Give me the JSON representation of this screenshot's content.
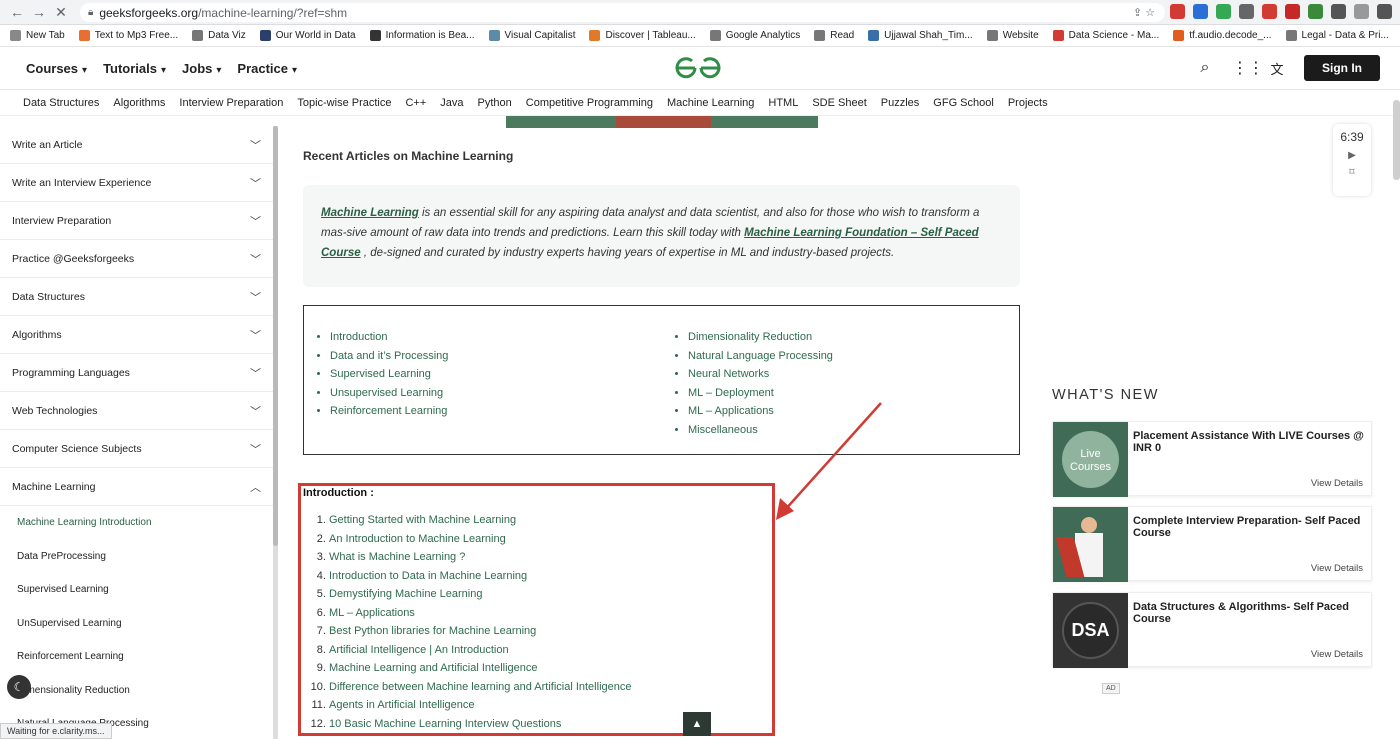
{
  "browser": {
    "url_host": "geeksforgeeks.org",
    "url_path": "/machine-learning/?ref=shm",
    "bookmarks": [
      {
        "label": "New Tab",
        "color": "#888"
      },
      {
        "label": "Text to Mp3 Free...",
        "color": "#e76f2f"
      },
      {
        "label": "Data Viz",
        "color": "#777"
      },
      {
        "label": "Our World in Data",
        "color": "#2a3f6a"
      },
      {
        "label": "Information is Bea...",
        "color": "#333"
      },
      {
        "label": "Visual Capitalist",
        "color": "#5c8aa8"
      },
      {
        "label": "Discover | Tableau...",
        "color": "#e07a2a"
      },
      {
        "label": "Google Analytics",
        "color": "#777"
      },
      {
        "label": "Read",
        "color": "#777"
      },
      {
        "label": "Ujjawal Shah_Tim...",
        "color": "#3a6ea8"
      },
      {
        "label": "Website",
        "color": "#777"
      },
      {
        "label": "Data Science - Ma...",
        "color": "#d13b34"
      },
      {
        "label": "tf.audio.decode_...",
        "color": "#e25b1f"
      },
      {
        "label": "Legal - Data & Pri...",
        "color": "#777"
      }
    ],
    "status_text": "Waiting for e.clarity.ms..."
  },
  "header": {
    "topnav": [
      "Courses",
      "Tutorials",
      "Jobs",
      "Practice"
    ],
    "signin_label": "Sign In",
    "logo_color": "#2f8d46"
  },
  "subnav": [
    "Data Structures",
    "Algorithms",
    "Interview Preparation",
    "Topic-wise Practice",
    "C++",
    "Java",
    "Python",
    "Competitive Programming",
    "Machine Learning",
    "HTML",
    "SDE Sheet",
    "Puzzles",
    "GFG School",
    "Projects"
  ],
  "sidebar": {
    "items": [
      {
        "label": "Write an Article",
        "chevron": "down"
      },
      {
        "label": "Write an Interview Experience",
        "chevron": "down"
      },
      {
        "label": "Interview Preparation",
        "chevron": "down"
      },
      {
        "label": "Practice @Geeksforgeeks",
        "chevron": "down"
      },
      {
        "label": "Data Structures",
        "chevron": "down"
      },
      {
        "label": "Algorithms",
        "chevron": "down"
      },
      {
        "label": "Programming Languages",
        "chevron": "down"
      },
      {
        "label": "Web Technologies",
        "chevron": "down"
      },
      {
        "label": "Computer Science Subjects",
        "chevron": "down"
      },
      {
        "label": "Machine Learning",
        "chevron": "up"
      }
    ],
    "sub_items": [
      "Machine Learning Introduction",
      "Data PreProcessing",
      "Supervised Learning",
      "UnSupervised Learning",
      "Reinforcement Learning",
      "Dimensionality Reduction",
      "Natural Language Processing"
    ]
  },
  "main": {
    "section_title": "Recent Articles on Machine Learning",
    "promo": {
      "link1": "Machine Learning",
      "text1": " is an essential skill for any aspiring data analyst and data scientist, and also for those who wish to transform a mas-sive amount of raw data into trends and predictions. Learn this skill today with ",
      "link2": "Machine Learning Foundation – Self Paced Course",
      "text2": " , de-signed and curated by industry experts having years of expertise in ML and industry-based projects."
    },
    "toc_left": [
      "Introduction",
      "Data and it’s Processing",
      "Supervised Learning",
      "Unsupervised Learning",
      "Reinforcement Learning"
    ],
    "toc_right": [
      "Dimensionality Reduction",
      "Natural Language Processing",
      "Neural Networks",
      "ML – Deployment",
      "ML – Applications",
      "Miscellaneous"
    ],
    "intro_heading": "Introduction :",
    "intro_items": [
      "Getting Started with Machine Learning",
      "An Introduction to Machine Learning",
      "What is Machine Learning ?",
      "Introduction to Data in Machine Learning",
      "Demystifying Machine Learning",
      "ML – Applications",
      "Best Python libraries for Machine Learning",
      "Artificial Intelligence | An Introduction",
      "Machine Learning and Artificial Intelligence",
      "Difference between Machine learning and Artificial Intelligence",
      "Agents in Artificial Intelligence",
      "10 Basic Machine Learning Interview Questions"
    ],
    "highlight_color": "#d13b34"
  },
  "right": {
    "video_time": "6:39",
    "whats_new": "WHAT'S NEW",
    "cards": [
      {
        "title": "Placement Assistance With LIVE Courses @ INR 0",
        "details": "View Details",
        "thumb_text": "Live Courses",
        "thumb_bg": "#3f6b57"
      },
      {
        "title": "Complete Interview Preparation- Self Paced Course",
        "details": "View Details",
        "thumb_text": "",
        "thumb_bg": "#3f6b57"
      },
      {
        "title": "Data Structures & Algorithms- Self Paced Course",
        "details": "View Details",
        "thumb_text": "DSA",
        "thumb_bg": "#333"
      }
    ],
    "ad_label": "AD"
  }
}
